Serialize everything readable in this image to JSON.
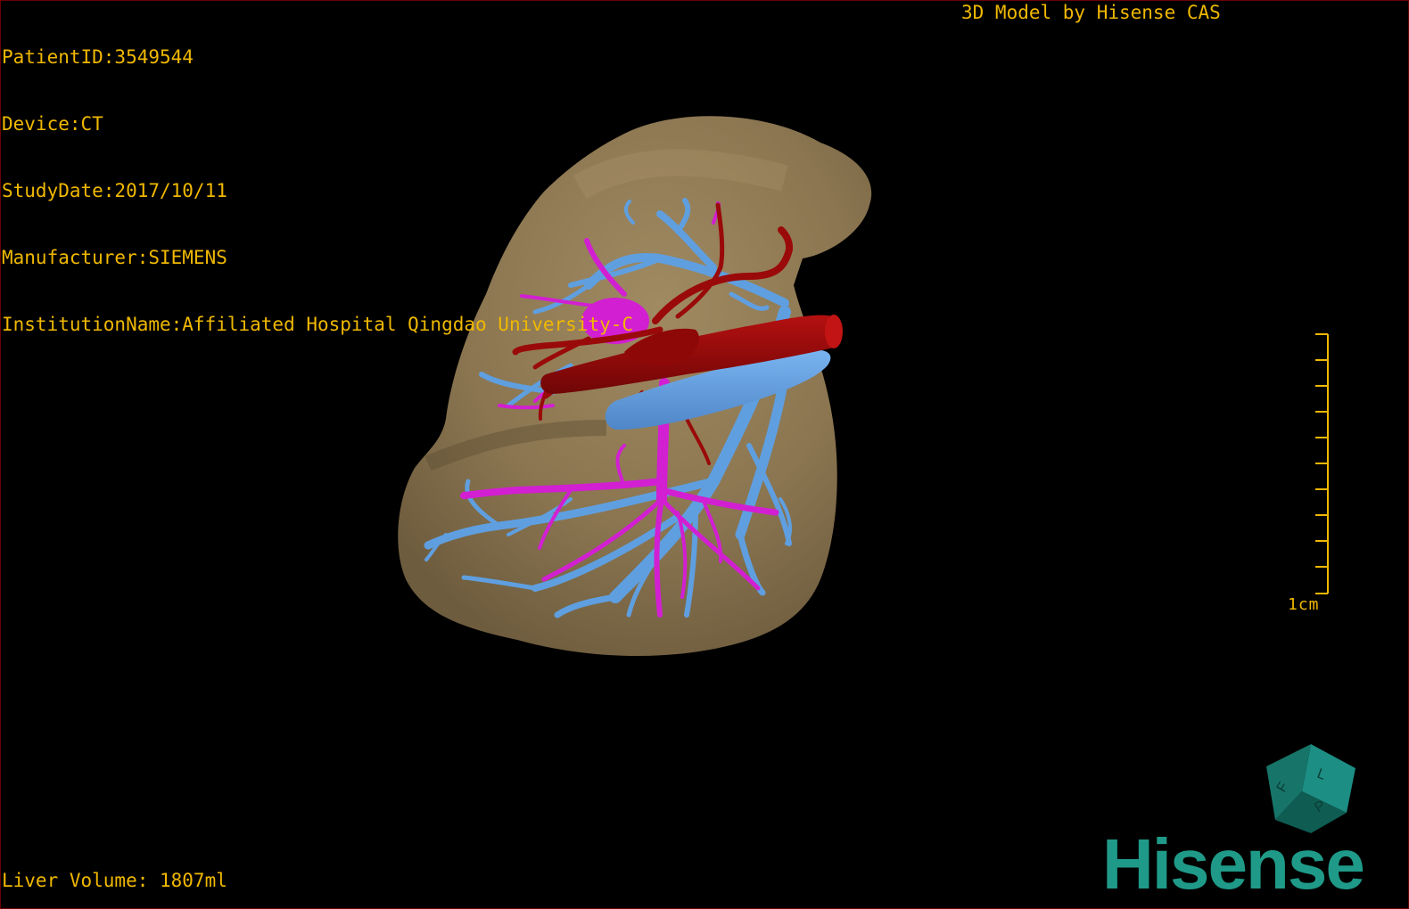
{
  "overlay": {
    "patient_id": "PatientID:3549544",
    "device": "Device:CT",
    "study_date": "StudyDate:2017/10/11",
    "manufacturer": "Manufacturer:SIEMENS",
    "institution": "InstitutionName:Affiliated Hospital Qingdao University-C",
    "model_by": "3D Model by Hisense CAS",
    "liver_volume": "Liver Volume: 1807ml"
  },
  "scale_bar": {
    "label": "1cm"
  },
  "orientation_cube": {
    "icon": "orientation-cube-icon"
  },
  "logo": {
    "text": "Hisense",
    "color": "#1f9a88"
  },
  "colors": {
    "text": "#f0b800",
    "liver": "#8a7550",
    "portal_vein": "#5f9fe0",
    "hepatic_artery": "#9a0a0a",
    "hepatic_vein": "#d21fd2",
    "border": "#6b0000"
  }
}
